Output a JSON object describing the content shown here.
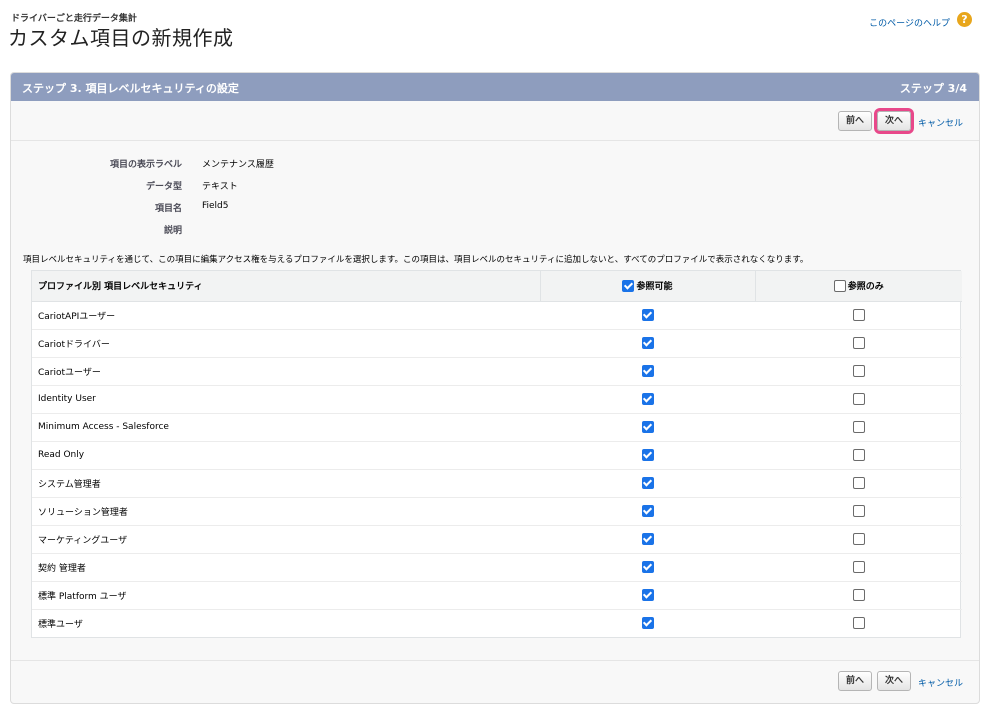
{
  "header": {
    "subtitle": "ドライバーごと走行データ集計",
    "title": "カスタム項目の新規作成",
    "help_link": "このページのヘルプ",
    "help_icon": "?"
  },
  "panel": {
    "title": "ステップ 3. 項目レベルセキュリティの設定",
    "step": "ステップ 3/4"
  },
  "buttons": {
    "prev": "前へ",
    "next": "次へ",
    "cancel": "キャンセル"
  },
  "field_info": [
    {
      "label": "項目の表示ラベル",
      "value": "メンテナンス履歴"
    },
    {
      "label": "データ型",
      "value": "テキスト"
    },
    {
      "label": "項目名",
      "value": "Field5"
    },
    {
      "label": "説明",
      "value": ""
    }
  ],
  "description": "項目レベルセキュリティを通じて、この項目に編集アクセス権を与えるプロファイルを選択します。この項目は、項目レベルのセキュリティに追加しないと、すべてのプロファイルで表示されなくなります。",
  "table": {
    "col_profile": "プロファイル別 項目レベルセキュリティ",
    "col_visible": "参照可能",
    "col_readonly": "参照のみ",
    "header_visible_checked": true,
    "header_readonly_checked": false,
    "rows": [
      {
        "name": "CariotAPIユーザー",
        "visible": true,
        "readonly": false
      },
      {
        "name": "Cariotドライバー",
        "visible": true,
        "readonly": false
      },
      {
        "name": "Cariotユーザー",
        "visible": true,
        "readonly": false
      },
      {
        "name": "Identity User",
        "visible": true,
        "readonly": false
      },
      {
        "name": "Minimum Access - Salesforce",
        "visible": true,
        "readonly": false
      },
      {
        "name": "Read Only",
        "visible": true,
        "readonly": false
      },
      {
        "name": "システム管理者",
        "visible": true,
        "readonly": false
      },
      {
        "name": "ソリューション管理者",
        "visible": true,
        "readonly": false
      },
      {
        "name": "マーケティングユーザ",
        "visible": true,
        "readonly": false
      },
      {
        "name": "契約 管理者",
        "visible": true,
        "readonly": false
      },
      {
        "name": "標準 Platform ユーザ",
        "visible": true,
        "readonly": false
      },
      {
        "name": "標準ユーザ",
        "visible": true,
        "readonly": false
      }
    ]
  },
  "colors": {
    "panel_header": "#8e9dbe",
    "link": "#015ba7",
    "checkbox_checked": "#1a73e8",
    "highlight": "#e8488a",
    "help_icon": "#e8a61c"
  }
}
